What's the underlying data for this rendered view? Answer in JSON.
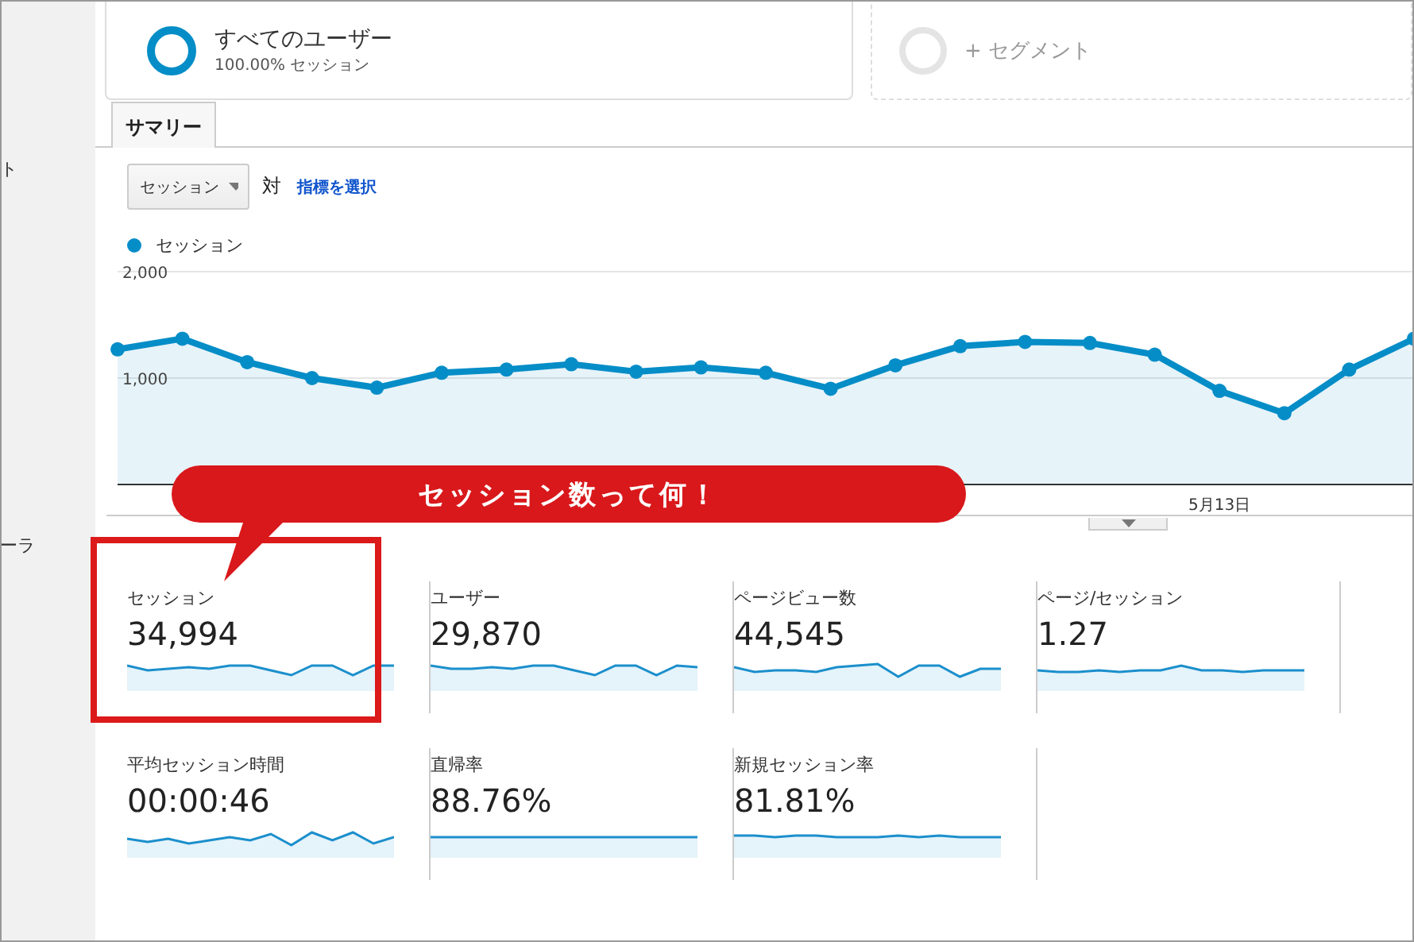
{
  "sidebar": {
    "items": [
      "ト",
      "ーラ"
    ]
  },
  "segments": [
    {
      "kind": "active",
      "name": "すべてのユーザー",
      "percent": "100.00%",
      "metric": "セッション"
    },
    {
      "kind": "add",
      "name": "+ セグメント"
    }
  ],
  "tabs": [
    {
      "label": "サマリー",
      "selected": true
    }
  ],
  "controls": {
    "metric_dropdown": "セッション",
    "versus": "対",
    "select_metric_link": "指標を選択"
  },
  "chart": {
    "date_label": "5月13日",
    "chart_data": {
      "type": "area",
      "series": [
        {
          "name": "セッション",
          "color": "#058dc7",
          "values": [
            1270,
            1370,
            1150,
            1000,
            910,
            1050,
            1080,
            1130,
            1060,
            1100,
            1050,
            900,
            1120,
            1300,
            1340,
            1330,
            1220,
            880,
            670,
            1080,
            1370
          ]
        }
      ],
      "ylim": [
        0,
        2000
      ],
      "yticks": [
        {
          "value": 1000,
          "label": "1,000"
        },
        {
          "value": 2000,
          "label": "2,000"
        }
      ]
    }
  },
  "callout": {
    "text": "セッション数って何！"
  },
  "metrics": [
    {
      "label": "セッション",
      "value": "34,994",
      "highlighted": true
    },
    {
      "label": "ユーザー",
      "value": "29,870",
      "highlighted": false
    },
    {
      "label": "ページビュー数",
      "value": "44,545",
      "highlighted": false
    },
    {
      "label": "ページ/セッション",
      "value": "1.27",
      "highlighted": false
    },
    {
      "label": "平均セッション時間",
      "value": "00:00:46",
      "highlighted": false
    },
    {
      "label": "直帰率",
      "value": "88.76%",
      "highlighted": false
    },
    {
      "label": "新規セッション率",
      "value": "81.81%",
      "highlighted": false
    }
  ]
}
